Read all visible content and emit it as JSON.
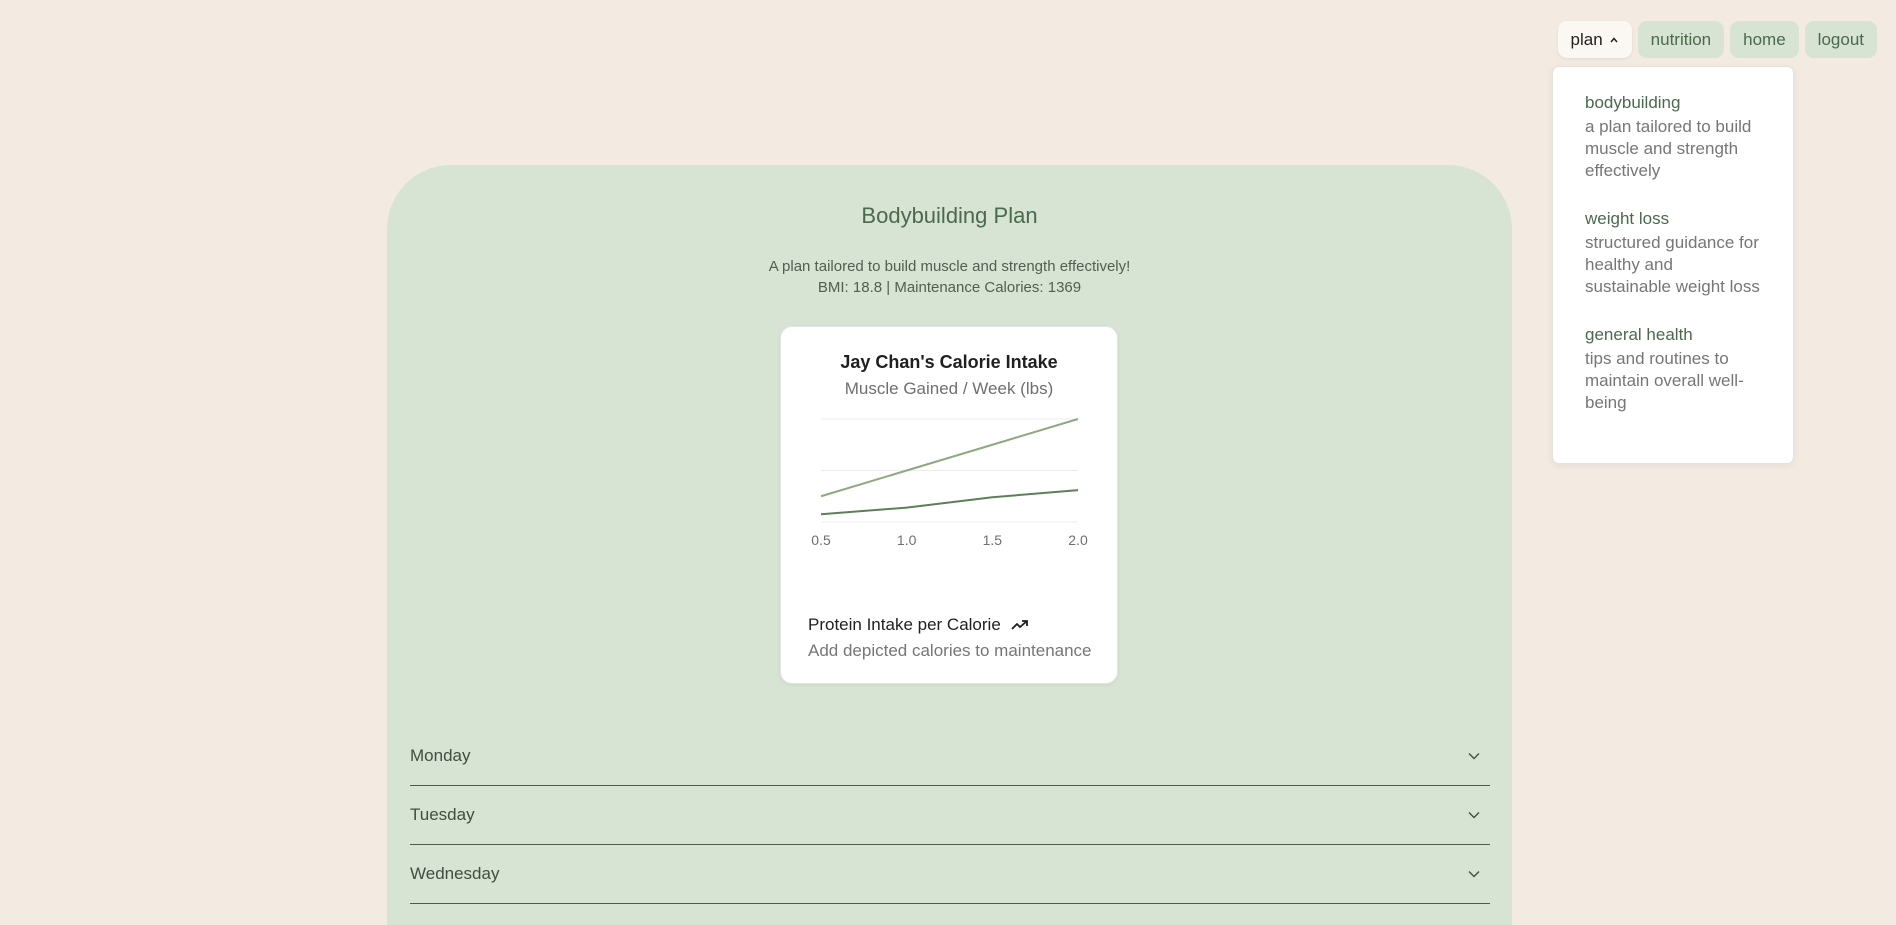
{
  "nav": {
    "items": [
      {
        "label": "plan",
        "active": true
      },
      {
        "label": "nutrition"
      },
      {
        "label": "home"
      },
      {
        "label": "logout"
      }
    ]
  },
  "dropdown": {
    "items": [
      {
        "title": "bodybuilding",
        "desc": "a plan tailored to build muscle and strength effectively"
      },
      {
        "title": "weight loss",
        "desc": "structured guidance for healthy and sustainable weight loss"
      },
      {
        "title": "general health",
        "desc": "tips and routines to maintain overall well-being"
      }
    ]
  },
  "plan": {
    "title": "Bodybuilding Plan",
    "description": "A plan tailored to build muscle and strength effectively!",
    "stats": "BMI: 18.8 | Maintenance Calories: 1369"
  },
  "card": {
    "footer": "Protein Intake per Calorie",
    "footer_sub": "Add depicted calories to maintenance"
  },
  "chart_data": {
    "type": "line",
    "title": "Jay Chan's Calorie Intake",
    "subtitle": "Muscle Gained / Week (lbs)",
    "x": [
      0.5,
      1.0,
      1.5,
      2.0
    ],
    "xlim": [
      0.5,
      2.0
    ],
    "ylim": [
      0,
      2
    ],
    "grid": true,
    "series": [
      {
        "values": [
          0.5,
          1.0,
          1.5,
          2.0
        ],
        "color": "#8ea882"
      },
      {
        "values": [
          0.15,
          0.28,
          0.48,
          0.62
        ],
        "color": "#5e7f5a"
      }
    ]
  },
  "days": [
    "Monday",
    "Tuesday",
    "Wednesday"
  ],
  "colors": {
    "background": "#f3ebe2",
    "panel": "#d7e3d3",
    "accent": "#4a6a4c"
  }
}
